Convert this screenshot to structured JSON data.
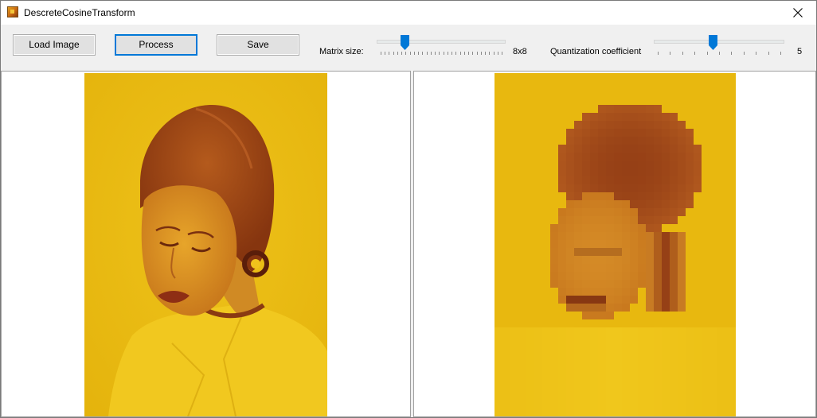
{
  "window": {
    "title": "DescreteCosineTransform",
    "app_icon": "dct-app-icon",
    "close_icon": "close-icon"
  },
  "toolbar": {
    "load_label": "Load Image",
    "process_label": "Process",
    "save_label": "Save",
    "matrix_size": {
      "label": "Matrix size:",
      "value_text": "8x8",
      "position_fraction": 0.2
    },
    "quantization": {
      "label": "Quantization coefficient",
      "value_text": "5",
      "position_fraction": 0.45
    }
  },
  "panels": {
    "original": {
      "image": "portrait-original-image"
    },
    "processed": {
      "image": "portrait-dct-processed-image"
    }
  },
  "colors": {
    "photo_background": "#e8b80f",
    "hair": "#9e4518",
    "shirt": "#f0c71c",
    "accent": "#0078d7"
  }
}
